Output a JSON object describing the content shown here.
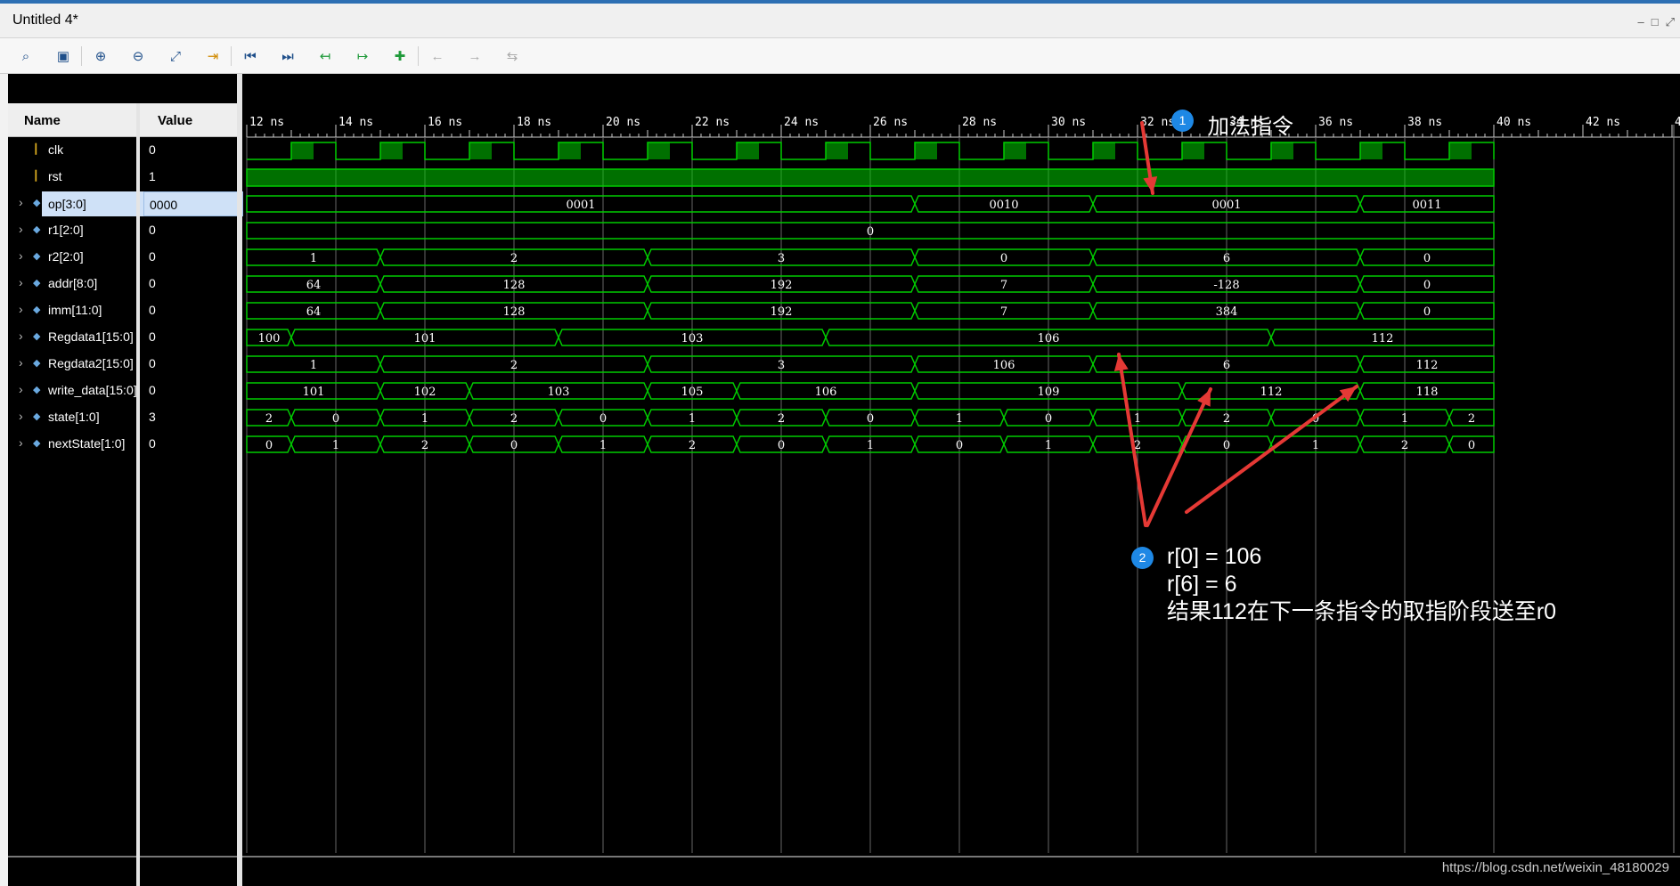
{
  "window": {
    "title": "Untitled 4*",
    "controls": [
      "–",
      "□",
      "⤢"
    ]
  },
  "toolbar": {
    "tools": [
      {
        "icon": "search-icon",
        "glyph": "⌕"
      },
      {
        "icon": "save-icon",
        "glyph": "▣"
      },
      {
        "icon": "zoom-in-icon",
        "glyph": "⊕"
      },
      {
        "icon": "zoom-out-icon",
        "glyph": "⊖"
      },
      {
        "icon": "zoom-fit-icon",
        "glyph": "⤢"
      },
      {
        "icon": "go-to-cursor-icon",
        "glyph": "⇥"
      },
      {
        "icon": "go-to-time-zero-icon",
        "glyph": "⏮"
      },
      {
        "icon": "go-to-last-time-icon",
        "glyph": "⏭"
      },
      {
        "icon": "previous-transition-icon",
        "glyph": "↤"
      },
      {
        "icon": "next-transition-icon",
        "glyph": "↦"
      },
      {
        "icon": "add-marker-icon",
        "glyph": "✚"
      },
      {
        "icon": "previous-marker-icon",
        "glyph": "←"
      },
      {
        "icon": "next-marker-icon",
        "glyph": "→"
      },
      {
        "icon": "swap-cursors-icon",
        "glyph": "⇆"
      }
    ]
  },
  "columns": {
    "name": "Name",
    "value": "Value"
  },
  "signals": [
    {
      "name": "clk",
      "value": "0",
      "kind": "bit"
    },
    {
      "name": "rst",
      "value": "1",
      "kind": "bit"
    },
    {
      "name": "op[3:0]",
      "value": "0000",
      "kind": "bus",
      "selected": true
    },
    {
      "name": "r1[2:0]",
      "value": "0",
      "kind": "bus"
    },
    {
      "name": "r2[2:0]",
      "value": "0",
      "kind": "bus"
    },
    {
      "name": "addr[8:0]",
      "value": "0",
      "kind": "bus"
    },
    {
      "name": "imm[11:0]",
      "value": "0",
      "kind": "bus"
    },
    {
      "name": "Regdata1[15:0]",
      "value": "0",
      "kind": "bus"
    },
    {
      "name": "Regdata2[15:0]",
      "value": "0",
      "kind": "bus"
    },
    {
      "name": "write_data[15:0]",
      "value": "0",
      "kind": "bus"
    },
    {
      "name": "state[1:0]",
      "value": "3",
      "kind": "bus"
    },
    {
      "name": "nextState[1:0]",
      "value": "0",
      "kind": "bus"
    }
  ],
  "timeline": {
    "unit": "ns",
    "ticks": [
      "12 ns",
      "14 ns",
      "16 ns",
      "18 ns",
      "20 ns",
      "22 ns",
      "24 ns",
      "26 ns",
      "28 ns",
      "30 ns",
      "32 ns",
      "34 ns",
      "36 ns",
      "38 ns",
      "40 ns",
      "42 ns",
      "4"
    ],
    "start": 12,
    "end": 40
  },
  "waves": {
    "clk": {
      "period": 2,
      "first_high": 13
    },
    "rst": {
      "level": 1
    },
    "op": [
      {
        "from": 12,
        "to": 27,
        "v": "0001"
      },
      {
        "from": 27,
        "to": 31,
        "v": "0010"
      },
      {
        "from": 31,
        "to": 37,
        "v": "0001"
      },
      {
        "from": 37,
        "to": 40,
        "v": "0011"
      }
    ],
    "r1": [
      {
        "from": 12,
        "to": 40,
        "v": "0"
      }
    ],
    "r2": [
      {
        "from": 12,
        "to": 15,
        "v": "1"
      },
      {
        "from": 15,
        "to": 21,
        "v": "2"
      },
      {
        "from": 21,
        "to": 27,
        "v": "3"
      },
      {
        "from": 27,
        "to": 31,
        "v": "0"
      },
      {
        "from": 31,
        "to": 37,
        "v": "6"
      },
      {
        "from": 37,
        "to": 40,
        "v": "0"
      }
    ],
    "addr": [
      {
        "from": 12,
        "to": 15,
        "v": "64"
      },
      {
        "from": 15,
        "to": 21,
        "v": "128"
      },
      {
        "from": 21,
        "to": 27,
        "v": "192"
      },
      {
        "from": 27,
        "to": 31,
        "v": "7"
      },
      {
        "from": 31,
        "to": 37,
        "v": "-128"
      },
      {
        "from": 37,
        "to": 40,
        "v": "0"
      }
    ],
    "imm": [
      {
        "from": 12,
        "to": 15,
        "v": "64"
      },
      {
        "from": 15,
        "to": 21,
        "v": "128"
      },
      {
        "from": 21,
        "to": 27,
        "v": "192"
      },
      {
        "from": 27,
        "to": 31,
        "v": "7"
      },
      {
        "from": 31,
        "to": 37,
        "v": "384"
      },
      {
        "from": 37,
        "to": 40,
        "v": "0"
      }
    ],
    "Regdata1": [
      {
        "from": 12,
        "to": 13,
        "v": "100"
      },
      {
        "from": 13,
        "to": 19,
        "v": "101"
      },
      {
        "from": 19,
        "to": 25,
        "v": "103"
      },
      {
        "from": 25,
        "to": 35,
        "v": "106"
      },
      {
        "from": 35,
        "to": 40,
        "v": "112"
      }
    ],
    "Regdata2": [
      {
        "from": 12,
        "to": 15,
        "v": "1"
      },
      {
        "from": 15,
        "to": 21,
        "v": "2"
      },
      {
        "from": 21,
        "to": 27,
        "v": "3"
      },
      {
        "from": 27,
        "to": 31,
        "v": "106"
      },
      {
        "from": 31,
        "to": 37,
        "v": "6"
      },
      {
        "from": 37,
        "to": 40,
        "v": "112"
      }
    ],
    "write_data": [
      {
        "from": 12,
        "to": 15,
        "v": "101"
      },
      {
        "from": 15,
        "to": 17,
        "v": "102"
      },
      {
        "from": 17,
        "to": 21,
        "v": "103"
      },
      {
        "from": 21,
        "to": 23,
        "v": "105"
      },
      {
        "from": 23,
        "to": 27,
        "v": "106"
      },
      {
        "from": 27,
        "to": 33,
        "v": "109"
      },
      {
        "from": 33,
        "to": 37,
        "v": "112"
      },
      {
        "from": 37,
        "to": 40,
        "v": "118"
      }
    ],
    "state": [
      {
        "from": 12,
        "to": 13,
        "v": "2"
      },
      {
        "from": 13,
        "to": 15,
        "v": "0"
      },
      {
        "from": 15,
        "to": 17,
        "v": "1"
      },
      {
        "from": 17,
        "to": 19,
        "v": "2"
      },
      {
        "from": 19,
        "to": 21,
        "v": "0"
      },
      {
        "from": 21,
        "to": 23,
        "v": "1"
      },
      {
        "from": 23,
        "to": 25,
        "v": "2"
      },
      {
        "from": 25,
        "to": 27,
        "v": "0"
      },
      {
        "from": 27,
        "to": 29,
        "v": "1"
      },
      {
        "from": 29,
        "to": 31,
        "v": "0"
      },
      {
        "from": 31,
        "to": 33,
        "v": "1"
      },
      {
        "from": 33,
        "to": 35,
        "v": "2"
      },
      {
        "from": 35,
        "to": 37,
        "v": "0"
      },
      {
        "from": 37,
        "to": 39,
        "v": "1"
      },
      {
        "from": 39,
        "to": 40,
        "v": "2"
      }
    ],
    "nextState": [
      {
        "from": 12,
        "to": 13,
        "v": "0"
      },
      {
        "from": 13,
        "to": 15,
        "v": "1"
      },
      {
        "from": 15,
        "to": 17,
        "v": "2"
      },
      {
        "from": 17,
        "to": 19,
        "v": "0"
      },
      {
        "from": 19,
        "to": 21,
        "v": "1"
      },
      {
        "from": 21,
        "to": 23,
        "v": "2"
      },
      {
        "from": 23,
        "to": 25,
        "v": "0"
      },
      {
        "from": 25,
        "to": 27,
        "v": "1"
      },
      {
        "from": 27,
        "to": 29,
        "v": "0"
      },
      {
        "from": 29,
        "to": 31,
        "v": "1"
      },
      {
        "from": 31,
        "to": 33,
        "v": "2"
      },
      {
        "from": 33,
        "to": 35,
        "v": "0"
      },
      {
        "from": 35,
        "to": 37,
        "v": "1"
      },
      {
        "from": 37,
        "to": 39,
        "v": "2"
      },
      {
        "from": 39,
        "to": 40,
        "v": "0"
      }
    ]
  },
  "annotations": {
    "a1": {
      "num": "1",
      "text": "加法指令"
    },
    "a2": {
      "num": "2",
      "lines": [
        "r[0] = 106",
        "r[6] = 6",
        "结果112在下一条指令的取指阶段送至r0"
      ]
    }
  },
  "colors": {
    "wave": "#00cc00",
    "bg": "#000000",
    "arrow": "#e53935",
    "badge": "#1e88e5"
  },
  "watermark": "https://blog.csdn.net/weixin_48180029"
}
